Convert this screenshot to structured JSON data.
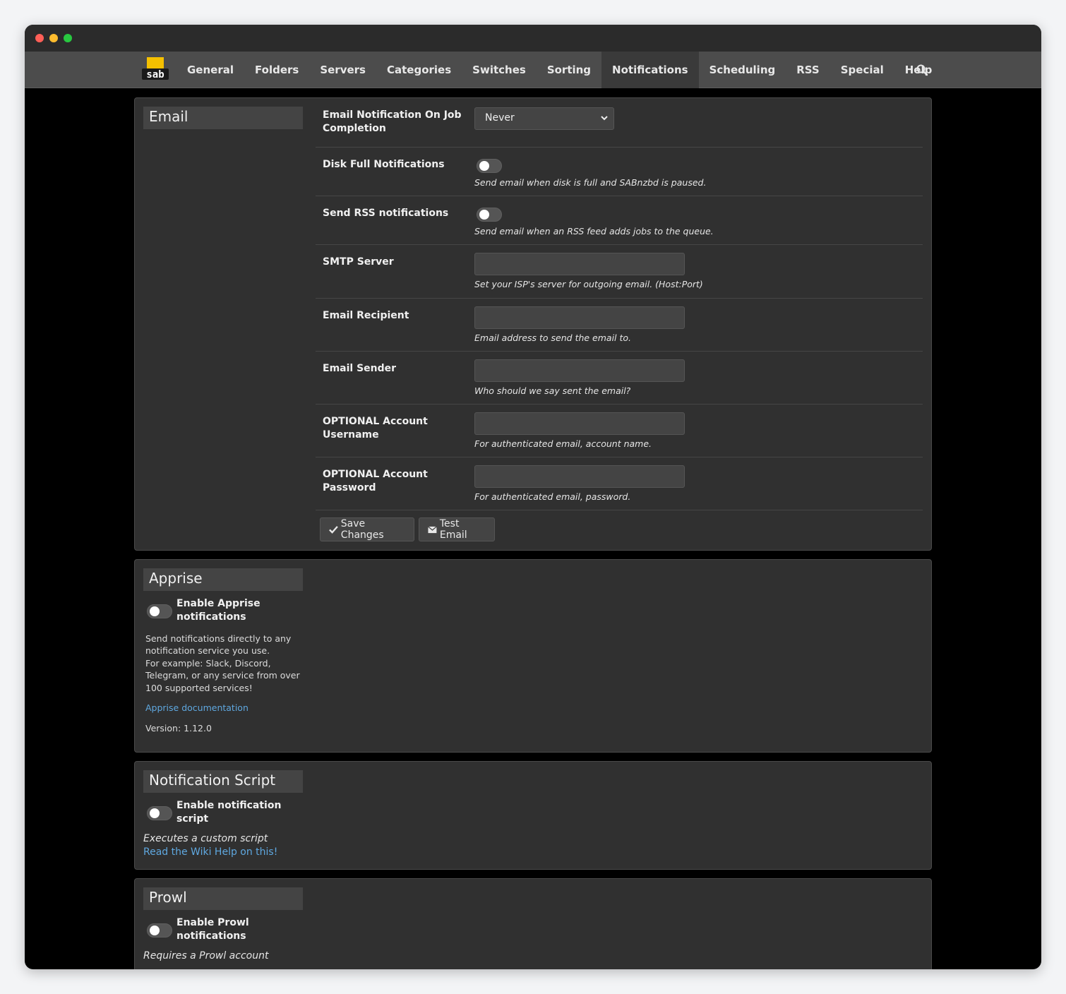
{
  "nav": {
    "items": [
      {
        "label": "General"
      },
      {
        "label": "Folders"
      },
      {
        "label": "Servers"
      },
      {
        "label": "Categories"
      },
      {
        "label": "Switches"
      },
      {
        "label": "Sorting"
      },
      {
        "label": "Notifications",
        "active": true
      },
      {
        "label": "Scheduling"
      },
      {
        "label": "RSS"
      },
      {
        "label": "Special"
      },
      {
        "label": "Help"
      }
    ],
    "search_icon": "search-icon",
    "logo_text": "sab"
  },
  "email": {
    "title": "Email",
    "job_completion": {
      "label": "Email Notification On Job Completion",
      "value": "Never"
    },
    "disk_full": {
      "label": "Disk Full Notifications",
      "help": "Send email when disk is full and SABnzbd is paused."
    },
    "rss": {
      "label": "Send RSS notifications",
      "help": "Send email when an RSS feed adds jobs to the queue."
    },
    "smtp": {
      "label": "SMTP Server",
      "help": "Set your ISP's server for outgoing email. (Host:Port)",
      "value": ""
    },
    "recipient": {
      "label": "Email Recipient",
      "help": "Email address to send the email to.",
      "value": ""
    },
    "sender": {
      "label": "Email Sender",
      "help": "Who should we say sent the email?",
      "value": ""
    },
    "username": {
      "label": "OPTIONAL Account Username",
      "help": "For authenticated email, account name.",
      "value": ""
    },
    "password": {
      "label": "OPTIONAL Account Password",
      "help": "For authenticated email, password.",
      "value": ""
    },
    "save_label": "Save Changes",
    "test_label": "Test Email"
  },
  "apprise": {
    "title": "Apprise",
    "enable_label": "Enable Apprise notifications",
    "desc_1": "Send notifications directly to any notification service you use.",
    "desc_2": "For example: Slack, Discord, Telegram, or any service from over 100 supported services!",
    "doc_link": "Apprise documentation",
    "version": "Version: 1.12.0"
  },
  "script": {
    "title": "Notification Script",
    "enable_label": "Enable notification script",
    "desc": "Executes a custom script",
    "link": "Read the Wiki Help on this!"
  },
  "prowl": {
    "title": "Prowl",
    "enable_label": "Enable Prowl notifications",
    "desc": "Requires a Prowl account"
  },
  "colors": {
    "accent": "#f5c000",
    "link": "#5fa8e0",
    "panel": "#303030",
    "nav": "#4c4c4c"
  }
}
